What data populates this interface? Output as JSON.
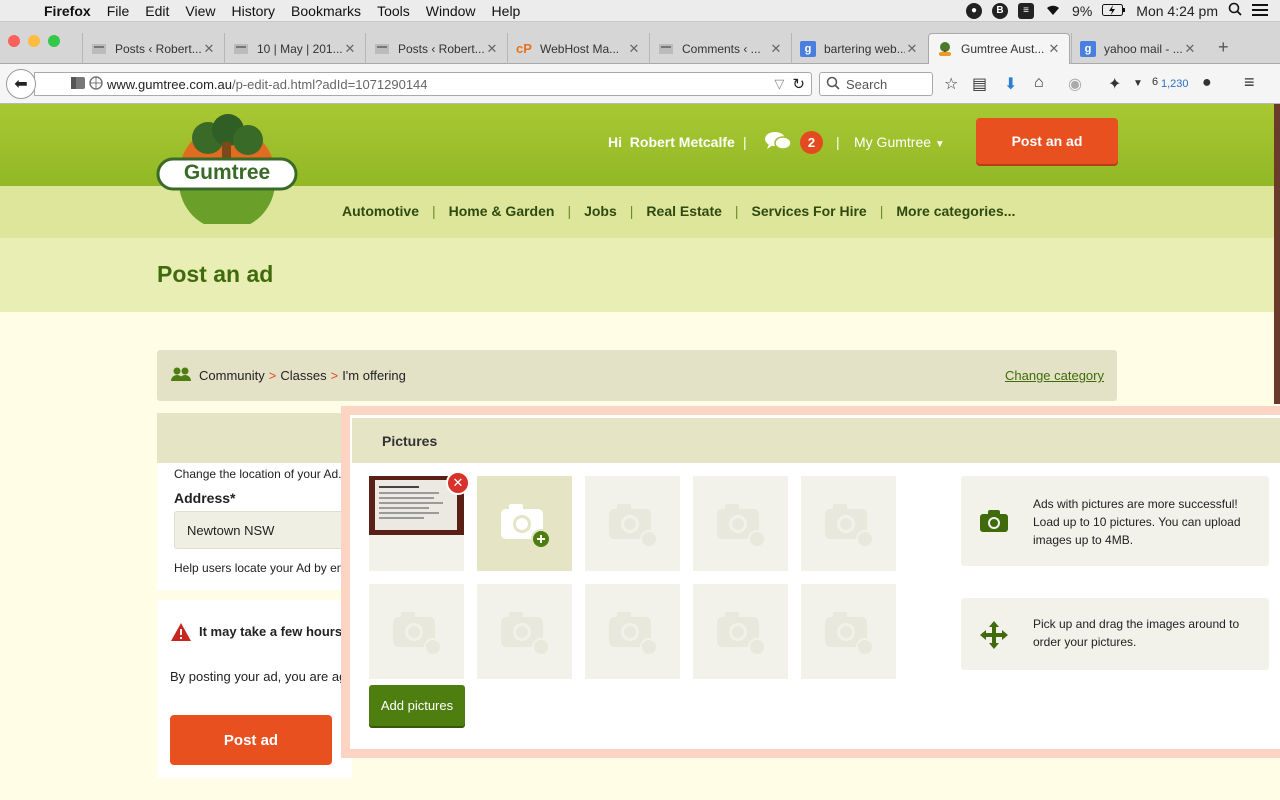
{
  "menubar": {
    "app": "Firefox",
    "items": [
      "File",
      "Edit",
      "View",
      "History",
      "Bookmarks",
      "Tools",
      "Window",
      "Help"
    ],
    "battery": "9%",
    "clock": "Mon 4:24 pm"
  },
  "tabs": [
    {
      "label": "Posts ‹ Robert...",
      "icon": "wordpress-icon"
    },
    {
      "label": "10 | May | 201...",
      "icon": "wordpress-icon"
    },
    {
      "label": "Posts ‹ Robert...",
      "icon": "wordpress-icon"
    },
    {
      "label": "WebHost Ma...",
      "icon": "cpanel-icon",
      "icon_text": "cP"
    },
    {
      "label": "Comments ‹ ...",
      "icon": "wordpress-icon"
    },
    {
      "label": "bartering web...",
      "icon": "google-icon",
      "icon_text": "g"
    },
    {
      "label": "Gumtree Aust...",
      "icon": "gumtree-icon",
      "active": true
    },
    {
      "label": "yahoo mail - ...",
      "icon": "google-icon",
      "icon_text": "g"
    }
  ],
  "navbar": {
    "url_domain": "www.gumtree.com.au",
    "url_path": "/p-edit-ad.html?adId=1071290144",
    "search_placeholder": "Search",
    "counter_a": "6",
    "counter_b": "1,230"
  },
  "header": {
    "logo_text": "Gumtree",
    "greeting_prefix": "Hi",
    "user_name": "Robert Metcalfe",
    "message_count": "2",
    "my_gumtree": "My Gumtree",
    "post_ad_button": "Post an ad"
  },
  "categories": [
    "Automotive",
    "Home & Garden",
    "Jobs",
    "Real Estate",
    "Services For Hire",
    "More categories..."
  ],
  "page": {
    "title": "Post an ad",
    "breadcrumb": [
      "Community",
      "Classes",
      "I'm offering"
    ],
    "change_category": "Change category",
    "location_hint": "Change the location of your Ad.",
    "address_label": "Address*",
    "address_value": "Newtown NSW",
    "address_help": "Help users locate your Ad by ente",
    "warning_text": "It may take a few hours",
    "terms_text": "By posting your ad, you are ag",
    "post_ad_button": "Post ad"
  },
  "pictures_panel": {
    "title": "Pictures",
    "add_button": "Add pictures",
    "tip_upload": "Ads with pictures are more successful! Load up to 10 pictures. You can upload images up to 4MB.",
    "tip_drag": "Pick up and drag the images around to order your pictures."
  },
  "colors": {
    "header_green": "#9dc02c",
    "accent_orange": "#e8501f",
    "brand_dark_green": "#3f6b0c"
  }
}
